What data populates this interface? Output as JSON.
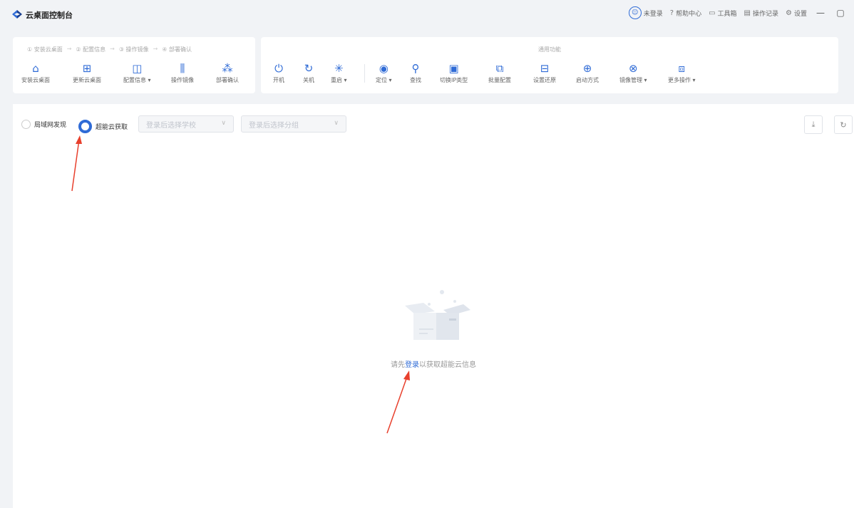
{
  "app": {
    "title": "云桌面控制台"
  },
  "topbar": {
    "user": "未登录",
    "help": "帮助中心",
    "toolbox": "工具箱",
    "logs": "操作记录",
    "settings": "设置",
    "minimize": "—",
    "maximize": "▢"
  },
  "steps": [
    "① 安装云桌面",
    "② 配置信息",
    "③ 操作镜像",
    "④ 部署确认"
  ],
  "step_tools": [
    {
      "label": "安装云桌面",
      "icon": "install-desktop-icon"
    },
    {
      "label": "更新云桌面",
      "icon": "update-desktop-icon"
    },
    {
      "label": "配置信息 ▾",
      "icon": "config-info-icon"
    },
    {
      "label": "操作镜像",
      "icon": "mirror-icon"
    },
    {
      "label": "部署确认",
      "icon": "deploy-confirm-icon"
    }
  ],
  "common": {
    "title": "通用功能",
    "tools": [
      {
        "label": "开机",
        "icon": "power-on-icon"
      },
      {
        "label": "关机",
        "icon": "power-off-icon"
      },
      {
        "label": "重启 ▾",
        "icon": "restart-icon"
      },
      {
        "label": "定位 ▾",
        "icon": "locate-icon"
      },
      {
        "label": "查找",
        "icon": "search-icon"
      },
      {
        "label": "切换IP类型",
        "icon": "switch-ip-icon"
      },
      {
        "label": "批量配置",
        "icon": "batch-config-icon"
      },
      {
        "label": "设置还原",
        "icon": "restore-icon"
      },
      {
        "label": "启动方式",
        "icon": "boot-mode-icon"
      },
      {
        "label": "镜像管理 ▾",
        "icon": "image-manage-icon"
      },
      {
        "label": "更多操作 ▾",
        "icon": "more-actions-icon"
      }
    ]
  },
  "filters": {
    "lan_discovery": "局域网发现",
    "cloud_fetch": "超能云获取",
    "school_placeholder": "登录后选择学校",
    "group_placeholder": "登录后选择分组"
  },
  "empty": {
    "prefix": "请先",
    "link": "登录",
    "suffix": "以获取超能云信息"
  },
  "colors": {
    "accent": "#2f6bd6",
    "arrow": "#e8402d"
  }
}
